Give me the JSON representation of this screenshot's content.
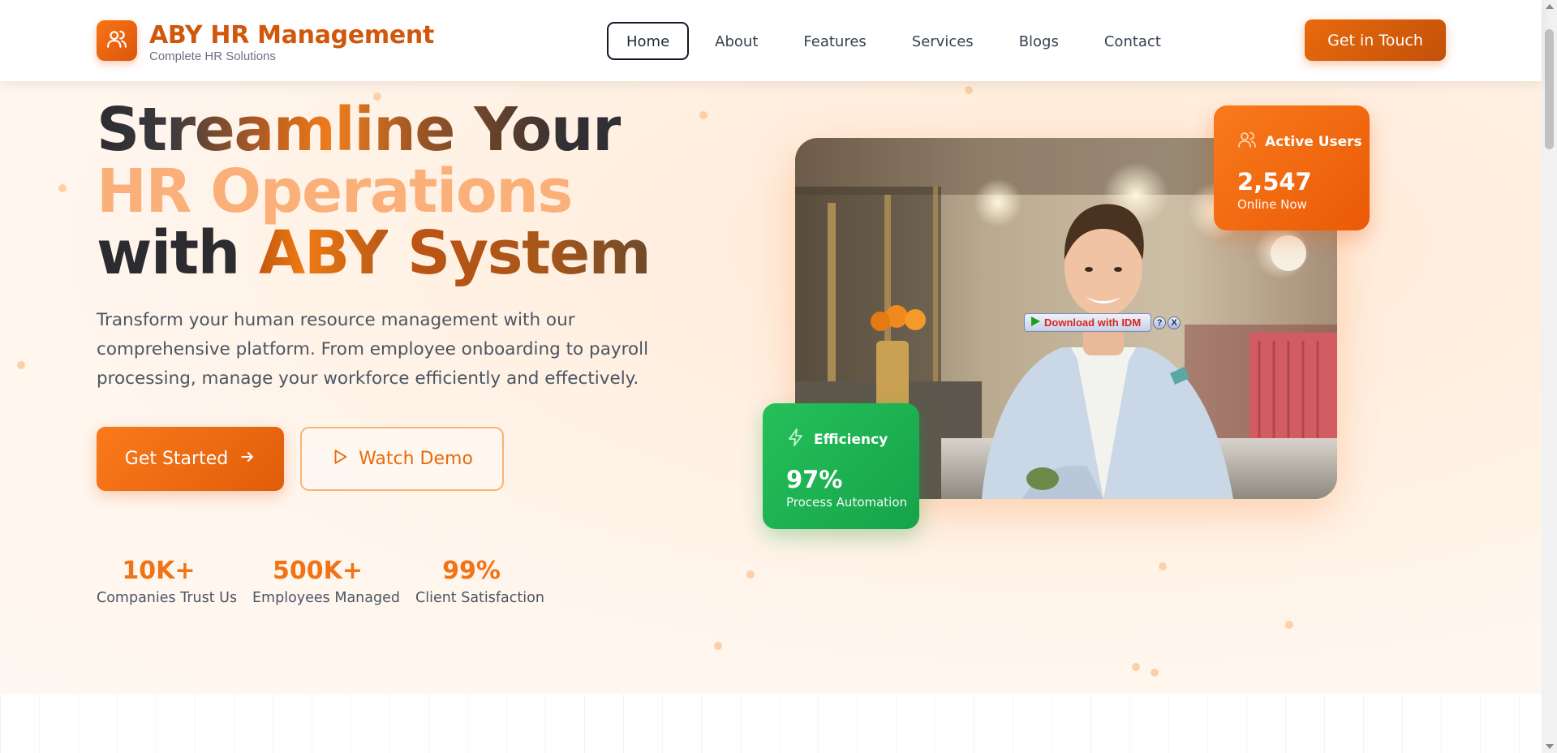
{
  "header": {
    "brand": "ABY HR Management",
    "tagline": "Complete HR Solutions",
    "logo_icon": "users-icon",
    "nav": [
      {
        "label": "Home",
        "active": true
      },
      {
        "label": "About"
      },
      {
        "label": "Features"
      },
      {
        "label": "Services"
      },
      {
        "label": "Blogs"
      },
      {
        "label": "Contact"
      }
    ],
    "cta_label": "Get in Touch"
  },
  "hero": {
    "headline": {
      "line1": "Streamline Your",
      "line2": "HR Operations",
      "line3_prefix": "with ",
      "line3_accent": "ABY",
      "line3_rest": " System"
    },
    "description": "Transform your human resource management with our comprehensive platform. From employee onboarding to payroll processing, manage your workforce efficiently and effectively.",
    "primary_button": "Get Started",
    "secondary_button": "Watch Demo",
    "stats": [
      {
        "value": "10K+",
        "label": "Companies Trust Us"
      },
      {
        "value": "500K+",
        "label": "Employees Managed"
      },
      {
        "value": "99%",
        "label": "Client Satisfaction"
      }
    ]
  },
  "cards": {
    "users": {
      "title": "Active Users",
      "value": "2,547",
      "subtitle": "Online Now",
      "icon": "users-icon"
    },
    "efficiency": {
      "title": "Efficiency",
      "value": "97%",
      "subtitle": "Process Automation",
      "icon": "lightning-icon"
    }
  },
  "idm": {
    "label": "Download with IDM",
    "help": "?",
    "close": "X"
  },
  "colors": {
    "accent": "#ea6a0c",
    "accent_dark": "#c2510a",
    "success": "#16a34a",
    "text_dark": "#2c2c30"
  }
}
